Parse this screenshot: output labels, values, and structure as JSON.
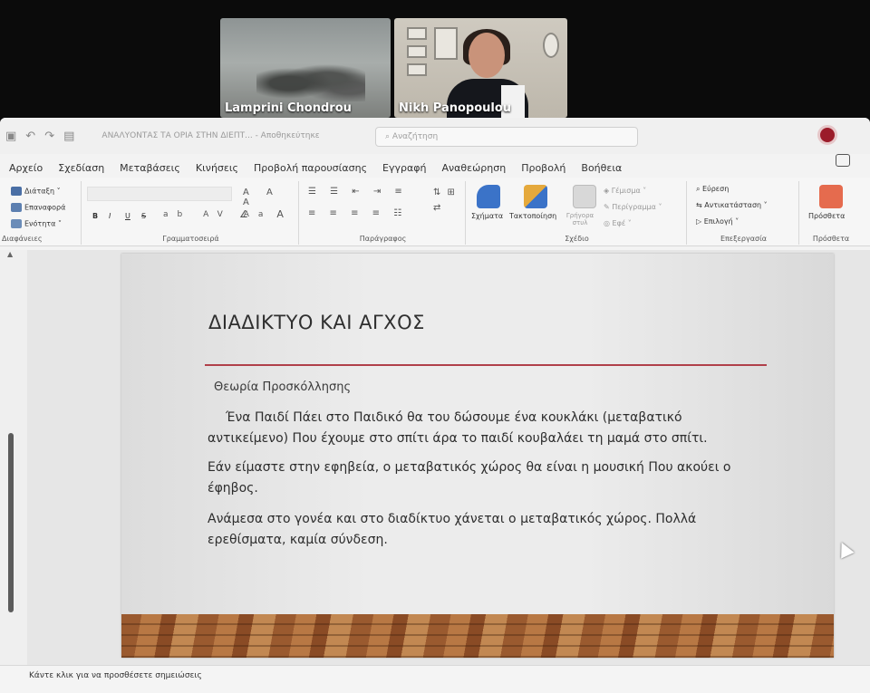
{
  "video": {
    "participants": [
      {
        "name": "Lamprini Chondrou"
      },
      {
        "name": "Nikh Panopoulou"
      }
    ]
  },
  "titlebar": {
    "doc_title": "ΑΝΑΛΥΟΝΤΑΣ ΤΑ ΟΡΙΑ ΣΤΗΝ ΔΙΕΠΤ... - Αποθηκεύτηκε",
    "search_placeholder": "Αναζήτηση"
  },
  "menu": {
    "items": [
      "Αρχείο",
      "Σχεδίαση",
      "Μεταβάσεις",
      "Κινήσεις",
      "Προβολή παρουσίασης",
      "Εγγραφή",
      "Αναθεώρηση",
      "Προβολή",
      "Βοήθεια"
    ]
  },
  "ribbon": {
    "slides_group": {
      "layout": "Διάταξη",
      "reset": "Επαναφορά",
      "section": "Ενότητα",
      "label": "Διαφάνειες"
    },
    "font_group": {
      "label": "Γραμματοσειρά",
      "bold": "B",
      "italic": "I",
      "underline": "U",
      "strike": "S"
    },
    "paragraph_group": {
      "label": "Παράγραφος"
    },
    "drawing_group": {
      "shapes": "Σχήματα",
      "arrange": "Τακτοποίηση",
      "quick_styles": "Γρήγορα στυλ",
      "fill": "Γέμισμα",
      "outline": "Περίγραμμα",
      "effects": "Εφέ",
      "label": "Σχέδιο"
    },
    "editing_group": {
      "find": "Εύρεση",
      "replace": "Αντικατάσταση",
      "select": "Επιλογή",
      "label": "Επεξεργασία"
    },
    "addins_group": {
      "addins": "Πρόσθετα",
      "label": "Πρόσθετα"
    }
  },
  "slide": {
    "title": "ΔΙΑΔΙΚΤΥΟ ΚΑΙ ΑΓΧΟΣ",
    "subtitle": "Θεωρία Προσκόλλησης",
    "paragraphs": [
      "Ένα Παιδί Πάει στο Παιδικό θα του δώσουμε ένα κουκλάκι (μεταβατικό αντικείμενο) Που έχουμε στο σπίτι άρα το παιδί κουβαλάει τη μαμά στο σπίτι.",
      "Εάν είμαστε στην εφηβεία, ο μεταβατικός χώρος θα είναι η μουσική Που ακούει ο έφηβος.",
      "Ανάμεσα στο γονέα και στο διαδίκτυο χάνεται ο μεταβατικός χώρος. Πολλά ερεθίσματα, καμία σύνδεση."
    ]
  },
  "notes": {
    "placeholder": "Κάντε κλικ για να προσθέσετε σημειώσεις"
  },
  "colors": {
    "accent_line": "#b0404a",
    "avatar": "#9b1c2a",
    "shapes_icon": "#3b73c8",
    "addins_icon": "#e56b4e"
  }
}
